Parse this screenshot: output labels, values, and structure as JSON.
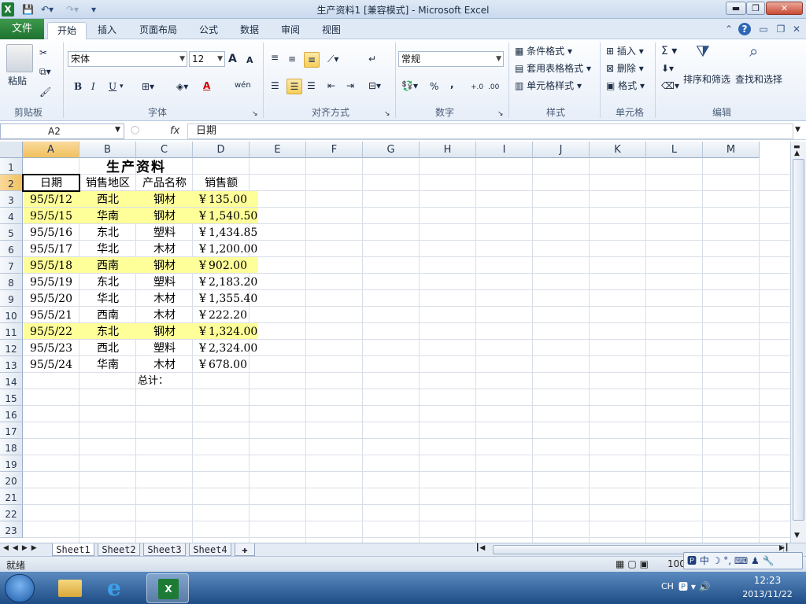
{
  "window": {
    "title": "生产资料1  [兼容模式] - Microsoft Excel",
    "app_icon": "X"
  },
  "ribbon_tabs": {
    "file": "文件",
    "tabs": [
      "开始",
      "插入",
      "页面布局",
      "公式",
      "数据",
      "审阅",
      "视图"
    ]
  },
  "ribbon": {
    "clipboard": {
      "paste": "粘贴",
      "label": "剪贴板"
    },
    "font": {
      "name": "宋体",
      "size": "12",
      "label": "字体",
      "bold": "B",
      "italic": "I",
      "underline": "U",
      "grow": "A",
      "shrink": "A",
      "fontcolor": "A",
      "phonetic": "wén"
    },
    "alignment": {
      "label": "对齐方式"
    },
    "number": {
      "format": "常规",
      "label": "数字",
      "percent": "%",
      "comma": ",",
      "inc": "+.0",
      "dec": ".00"
    },
    "styles": {
      "label": "样式",
      "conditional": "条件格式",
      "table": "套用表格格式",
      "cell": "单元格样式"
    },
    "cells": {
      "label": "单元格",
      "insert": "插入",
      "delete": "删除",
      "format": "格式"
    },
    "editing": {
      "label": "编辑",
      "sort": "排序和筛选",
      "find": "查找和选择",
      "sum": "Σ"
    }
  },
  "formula_bar": {
    "name_box": "A2",
    "fx": "fx",
    "content": "日期"
  },
  "columns": [
    "A",
    "B",
    "C",
    "D",
    "E",
    "F",
    "G",
    "H",
    "I",
    "J",
    "K",
    "L",
    "M"
  ],
  "rows": [
    "1",
    "2",
    "3",
    "4",
    "5",
    "6",
    "7",
    "8",
    "9",
    "10",
    "11",
    "12",
    "13",
    "14",
    "15",
    "16",
    "17",
    "18",
    "19",
    "20",
    "21",
    "22",
    "23"
  ],
  "sheet": {
    "title": "生产资料",
    "headers": [
      "日期",
      "销售地区",
      "产品名称",
      "销售额"
    ],
    "records": [
      [
        "95/5/12",
        "西北",
        "钢材",
        "135.00"
      ],
      [
        "95/5/15",
        "华南",
        "钢材",
        "1,540.50"
      ],
      [
        "95/5/16",
        "东北",
        "塑料",
        "1,434.85"
      ],
      [
        "95/5/17",
        "华北",
        "木材",
        "1,200.00"
      ],
      [
        "95/5/18",
        "西南",
        "钢材",
        "902.00"
      ],
      [
        "95/5/19",
        "东北",
        "塑料",
        "2,183.20"
      ],
      [
        "95/5/20",
        "华北",
        "木材",
        "1,355.40"
      ],
      [
        "95/5/21",
        "西南",
        "木材",
        "222.20"
      ],
      [
        "95/5/22",
        "东北",
        "钢材",
        "1,324.00"
      ],
      [
        "95/5/23",
        "西北",
        "塑料",
        "2,324.00"
      ],
      [
        "95/5/24",
        "华南",
        "木材",
        "678.00"
      ]
    ],
    "currency": "¥",
    "total_label": "总计：",
    "highlight_color": "#ffff99"
  },
  "sheet_tabs": [
    "Sheet1",
    "Sheet2",
    "Sheet3",
    "Sheet4"
  ],
  "status": {
    "ready": "就绪",
    "zoom": "100",
    "ime": "中"
  },
  "taskbar": {
    "lang": "CH",
    "time": "12:23",
    "date": "2013/11/22"
  }
}
